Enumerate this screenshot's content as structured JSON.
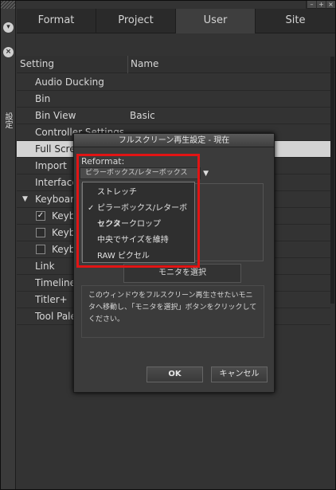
{
  "window_controls": [
    "–",
    "+",
    "×"
  ],
  "side": {
    "panel_label": "設定"
  },
  "tabs": [
    {
      "label": "Format"
    },
    {
      "label": "Project"
    },
    {
      "label": "User",
      "active": true
    },
    {
      "label": "Site"
    }
  ],
  "list": {
    "col_setting": "Setting",
    "col_name": "Name",
    "rows": [
      {
        "name": "Audio Ducking",
        "value": ""
      },
      {
        "name": "Bin",
        "value": ""
      },
      {
        "name": "Bin View",
        "value": "Basic"
      },
      {
        "name": "Controller Settings",
        "value": ""
      },
      {
        "name": "Full Scre",
        "value": "",
        "selected": true
      },
      {
        "name": "Import",
        "value": ""
      },
      {
        "name": "Interface",
        "value": ""
      },
      {
        "name": "Keyboar",
        "value": "",
        "expanded": true
      },
      {
        "name": "Keyb",
        "value": "",
        "checkbox": true,
        "checked": true
      },
      {
        "name": "Keyb",
        "value": "",
        "checkbox": true,
        "checked": false
      },
      {
        "name": "Keyb",
        "value": "",
        "checkbox": true,
        "checked": false
      },
      {
        "name": "Link",
        "value": ""
      },
      {
        "name": "Timeline",
        "value": ""
      },
      {
        "name": "Titler+",
        "value": ""
      },
      {
        "name": "Tool Pale",
        "value": ""
      }
    ]
  },
  "dialog": {
    "title": "フルスクリーン再生設定 - 現在",
    "reformat_label": "Reformat:",
    "reformat_value": "ピラーボックス/レターボックス",
    "monitor_button": "モニタを選択",
    "help_text": "このウィンドウをフルスクリーン再生させたいモニタへ移動し、「モニタを選択」ボタンをクリックしてください。",
    "ok": "OK",
    "cancel": "キャンセル"
  },
  "menu": {
    "items": [
      {
        "label": "ストレッチ",
        "checked": false
      },
      {
        "label": "ピラーボックス/レターボックス",
        "checked": true
      },
      {
        "label": "センタークロップ",
        "checked": false
      },
      {
        "label": "中央でサイズを維持",
        "checked": false
      },
      {
        "label": "RAW ピクセル",
        "checked": false
      }
    ],
    "check_mark": "✓"
  },
  "colors": {
    "highlight": "#e21414",
    "selected_row": "#d3d3d3"
  }
}
